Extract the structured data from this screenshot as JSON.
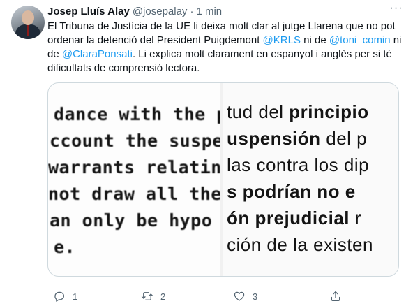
{
  "tweet": {
    "author_name": "Josep Lluís Alay",
    "author_handle": "@josepalay",
    "separator": "·",
    "timestamp": "1 min",
    "more_label": "···",
    "text": {
      "part1": "El Tribuna de Justícia de la UE li deixa molt clar al jutge Llarena que no pot ordenar la detenció del President Puigdemont ",
      "mention1": "@KRLS",
      "part2": " ni de ",
      "mention2": "@toni_comin",
      "part3": " ni de ",
      "mention3": "@ClaraPonsati",
      "part4": ". Li explica molt clarament en espanyol i anglès per si té dificultats de comprensió lectora."
    }
  },
  "media": {
    "left_lines": [
      "dance with the p",
      "ccount the suspe",
      " warrants relating",
      " not draw all the",
      "an only be hypo",
      "e."
    ],
    "right_lines": [
      {
        "normal": "tud del ",
        "bold": "principio"
      },
      {
        "normal": "",
        "bold": "uspensión",
        "tail": " del p"
      },
      {
        "normal": "las contra los dip",
        "bold": ""
      },
      {
        "normal": "",
        "bold": "s podrían no e"
      },
      {
        "normal": "",
        "bold": "ón prejudicial",
        "tail": " r"
      },
      {
        "normal": "ción de la existen",
        "bold": ""
      }
    ]
  },
  "actions": {
    "reply_count": "1",
    "retweet_count": "2",
    "like_count": "3",
    "reply_icon": "reply-icon",
    "retweet_icon": "retweet-icon",
    "like_icon": "heart-icon",
    "share_icon": "share-icon"
  }
}
